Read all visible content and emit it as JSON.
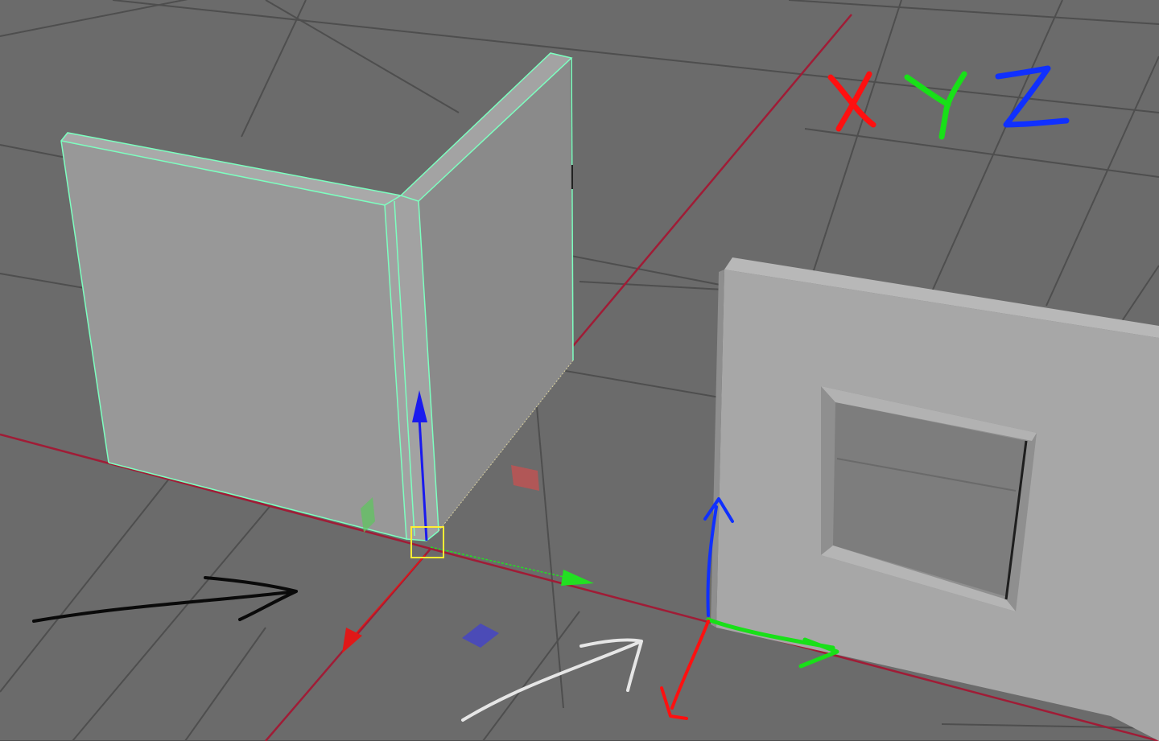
{
  "viewport": {
    "background": "#6b6b6b",
    "grid_color": "#4e4e4e",
    "axis_line_color": "#a01c36"
  },
  "annotation": {
    "letters": [
      "X",
      "Y",
      "Z"
    ],
    "colors": {
      "x": "#ff1010",
      "y": "#18e018",
      "z": "#1030ff"
    }
  },
  "objects": {
    "walls_corner": {
      "state": "selected",
      "wireframe_color": "#7dffc0"
    },
    "window_frame": {
      "state": "unselected"
    }
  },
  "manipulator": {
    "pivot_color": "#ffee33",
    "axis_colors": {
      "x": "#e01818",
      "y": "#22e022",
      "z": "#1a1aee"
    }
  },
  "drawn_arrows": [
    {
      "name": "black-arrow",
      "color": "#0a0a0a"
    },
    {
      "name": "white-arrow",
      "color": "#e6e6e6"
    }
  ],
  "icons": [
    "move-manipulator-icon",
    "world-axis-gizmo-icon",
    "scale-handle-icon",
    "plane-handle-icon"
  ]
}
